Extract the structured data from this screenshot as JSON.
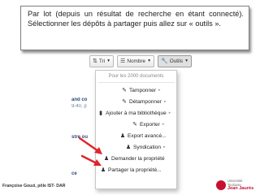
{
  "callout": {
    "text": "Par lot (depuis un résultat de recherche en étant connecté). Sélectionner les dépôts à partager puis allez sur « outils »."
  },
  "toolbar": {
    "sort_label": "Tri",
    "count_label": "Nombre",
    "tools_label": "Outils"
  },
  "background": {
    "snippet_1": "and co",
    "snippet_2": "9-40, p",
    "snippet_3": "stre ou",
    "snippet_4": "ce"
  },
  "menu": {
    "header": "Pour les 2000 documents",
    "items": [
      {
        "label": "Tamponner",
        "icon": "tag-icon",
        "submenu": true
      },
      {
        "label": "Détamponner",
        "icon": "tag-remove-icon",
        "submenu": true
      },
      {
        "label": "Ajouter à ma bibliothèque",
        "icon": "book-icon",
        "submenu": true
      },
      {
        "label": "Exporter",
        "icon": "export-icon",
        "submenu": true
      },
      {
        "label": "Export avancé...",
        "icon": "user-export-icon",
        "submenu": false
      },
      {
        "label": "Syndication",
        "icon": "user-syndication-icon",
        "submenu": true
      },
      {
        "label": "Demander la propriété",
        "icon": "user-request-icon",
        "submenu": false
      },
      {
        "label": "Partager la propriété...",
        "icon": "user-share-icon",
        "submenu": false
      }
    ]
  },
  "footer": {
    "author": "Françoise Gouzi, pôle IST- DAR"
  },
  "logo": {
    "line1": "Université Toulouse",
    "line2": "Jean Jaurès"
  },
  "colors": {
    "arrow": "#e0242a",
    "logo_accent": "#c8102e"
  }
}
